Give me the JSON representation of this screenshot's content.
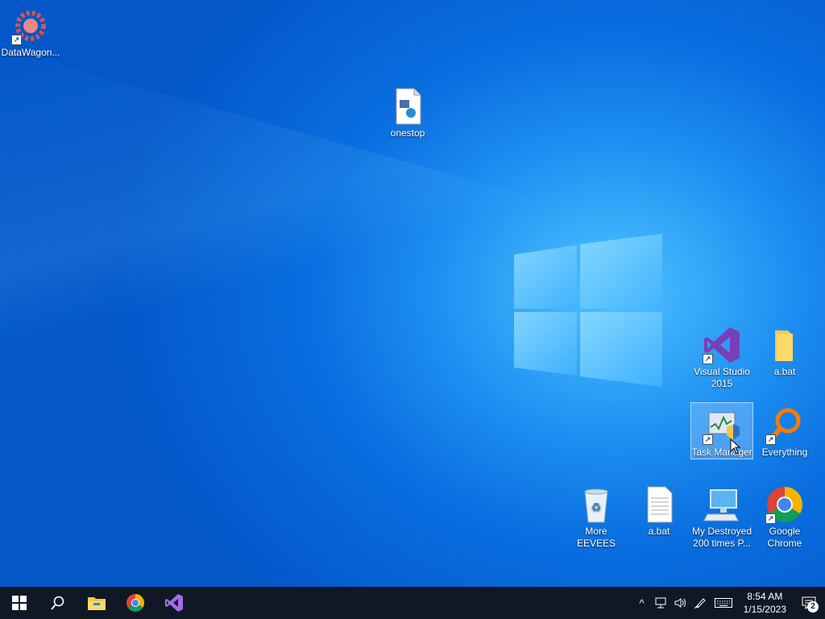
{
  "desktop": {
    "icons": [
      {
        "label": "DataWagon...",
        "icon": "gear-app-icon"
      },
      {
        "label": "onestop",
        "icon": "media-file-icon"
      },
      {
        "label": "Visual Studio 2015",
        "icon": "visual-studio-icon"
      },
      {
        "label": "a.bat",
        "icon": "folder-icon"
      },
      {
        "label": "Task Manager",
        "icon": "task-manager-icon"
      },
      {
        "label": "Everything",
        "icon": "everything-search-icon"
      },
      {
        "label": "More EEVEES",
        "icon": "recycle-bin-icon"
      },
      {
        "label": "a.bat",
        "icon": "text-document-icon"
      },
      {
        "label": "My Destroyed 200 times P...",
        "icon": "computer-icon"
      },
      {
        "label": "Google Chrome",
        "icon": "chrome-icon"
      }
    ]
  },
  "taskbar": {
    "pinned": [
      "start-windows-icon",
      "search-icon",
      "file-explorer-icon",
      "chrome-icon",
      "visual-studio-icon"
    ],
    "tray": {
      "time": "8:54 AM",
      "date": "1/15/2023",
      "notification_count": "2",
      "icons": [
        "chevron-up-icon",
        "network-icon",
        "volume-icon",
        "pen-icon",
        "keyboard-icon"
      ]
    }
  },
  "colors": {
    "taskbar_bg": "#101826",
    "desktop_blue": "#0a6fe0",
    "accent": "#1e90f2"
  }
}
